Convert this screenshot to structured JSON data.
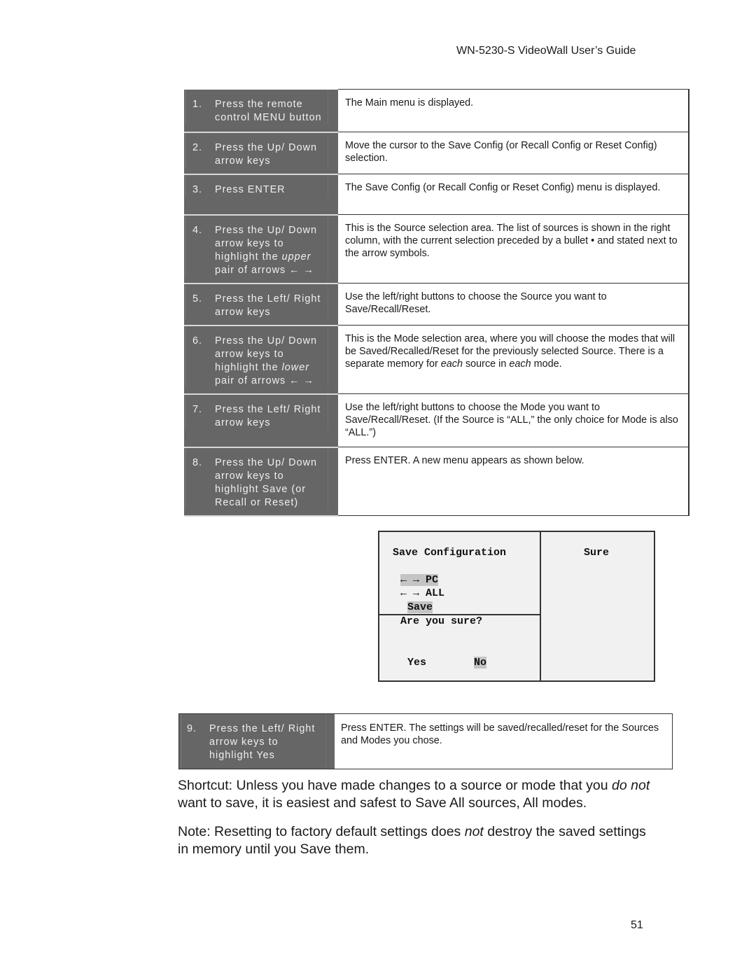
{
  "header": {
    "title": "WN-5230-S VideoWall User’s Guide"
  },
  "steps": [
    {
      "num": "1.",
      "action": "Press the remote control MENU button",
      "result": "The Main menu is displayed."
    },
    {
      "num": "2.",
      "action": "Press the Up/ Down arrow keys",
      "result": "Move the cursor to the Save Config (or Recall Config or Reset Config) selection."
    },
    {
      "num": "3.",
      "action": "Press ENTER",
      "result": "The Save Config (or Recall Config or Reset Config) menu is displayed."
    },
    {
      "num": "4.",
      "action_pre": "Press the Up/ Down arrow keys to highlight the ",
      "action_em": "upper",
      "action_post": " pair of arrows ← →",
      "result": "This is the Source selection area. The list of sources is shown in the right column, with the current selection preceded by a bullet  • and stated next to the arrow symbols."
    },
    {
      "num": "5.",
      "action": "Press the Left/ Right arrow keys",
      "result": "Use the left/right buttons to choose the Source you want to Save/Recall/Reset."
    },
    {
      "num": "6.",
      "action_pre": "Press the Up/ Down arrow keys to highlight the ",
      "action_em": "lower",
      "action_post": " pair of arrows ← →",
      "result_pre": "This is the Mode selection area, where you will choose the modes that will be Saved/Recalled/Reset for the previously selected Source. There is a separate memory for ",
      "result_em1": "each",
      "result_mid": " source in ",
      "result_em2": "each",
      "result_post": " mode."
    },
    {
      "num": "7.",
      "action": "Press the Left/ Right arrow keys",
      "result": "Use the left/right buttons to choose the Mode you want to Save/Recall/Reset. (If the Source is “ALL,” the only choice for Mode is also “ALL.”)"
    },
    {
      "num": "8.",
      "action": "Press the Up/ Down arrow keys to highlight Save (or Recall or Reset)",
      "result": "Press ENTER. A new menu appears as shown below."
    }
  ],
  "osd": {
    "title": "Save Configuration",
    "right_title": "Sure",
    "source_line": "← → PC",
    "mode_line": "← → ALL",
    "action": "Save",
    "question": "Are you sure?",
    "yes": "Yes",
    "no": "No"
  },
  "step9": {
    "num": "9.",
    "action": "Press the Left/ Right arrow keys to highlight Yes",
    "result": "Press ENTER. The settings will be saved/recalled/reset for the Sources and Modes you chose."
  },
  "shortcut": {
    "pre": "Shortcut: Unless you have made changes to a source or mode that you ",
    "em1": "do not",
    "post": " want to save, it is easiest and safest to Save All sources, All modes."
  },
  "note": {
    "pre": "Note: Resetting to factory default settings does ",
    "em": "not",
    "post": " destroy the saved settings in memory until you Save them."
  },
  "page_number": "51"
}
